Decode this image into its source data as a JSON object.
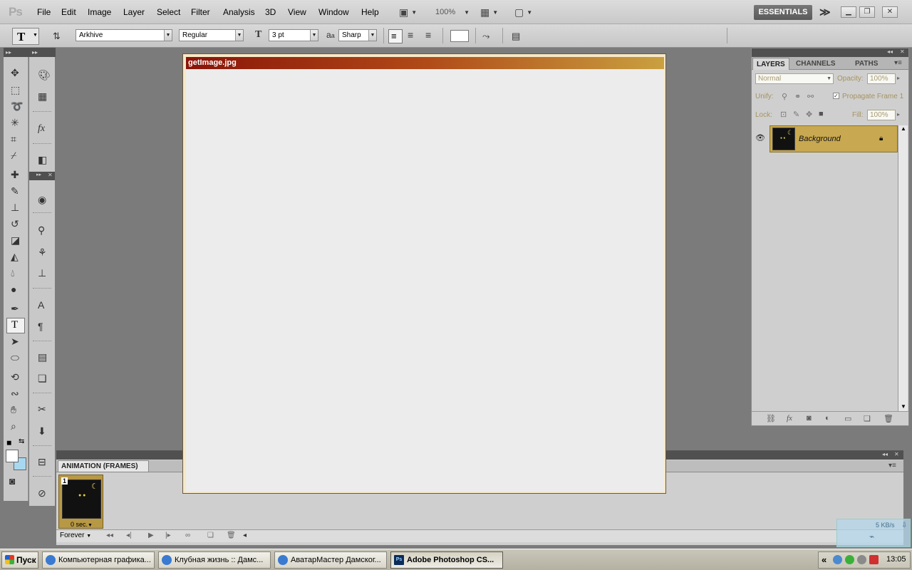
{
  "app": {
    "logo": "Ps",
    "menu": [
      "File",
      "Edit",
      "Image",
      "Layer",
      "Select",
      "Filter",
      "Analysis",
      "3D",
      "View",
      "Window",
      "Help"
    ],
    "zoom": "100%",
    "workspace": "ESSENTIALS"
  },
  "options": {
    "font_family": "Arkhive",
    "font_style": "Regular",
    "font_size": "3 pt",
    "aa_label": "a",
    "antialias": "Sharp"
  },
  "document": {
    "title": "getImage.jpg",
    "canvas_color": "#ececec"
  },
  "layers_panel": {
    "tabs": [
      "LAYERS",
      "CHANNELS",
      "PATHS"
    ],
    "blend_mode": "Normal",
    "opacity_label": "Opacity:",
    "opacity": "100%",
    "unify_label": "Unify:",
    "propagate_label": "Propagate Frame 1",
    "lock_label": "Lock:",
    "fill_label": "Fill:",
    "fill": "100%",
    "layers": [
      {
        "name": "Background",
        "locked": true,
        "visible": true
      }
    ]
  },
  "animation": {
    "tab": "ANIMATION (FRAMES)",
    "frames": [
      {
        "number": "1",
        "delay": "0 sec."
      }
    ],
    "loop": "Forever"
  },
  "netmon": {
    "speed": "5 KB/s"
  },
  "taskbar": {
    "start": "Пуск",
    "tasks": [
      {
        "label": "Компьютерная графика...",
        "active": false
      },
      {
        "label": "Клубная жизнь :: Дамс...",
        "active": false
      },
      {
        "label": "АватарМастер Дамског...",
        "active": false
      },
      {
        "label": "Adobe Photoshop CS...",
        "active": true
      }
    ],
    "tray_expand": "«",
    "clock": "13:05"
  }
}
